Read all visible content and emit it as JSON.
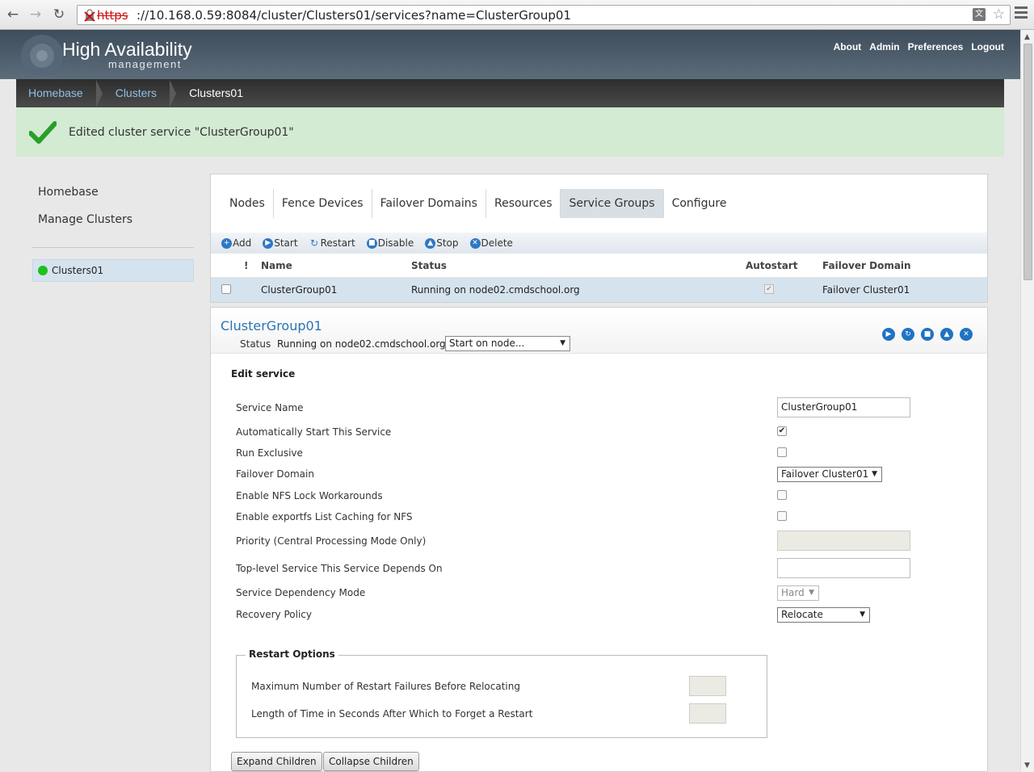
{
  "browser": {
    "url_protocol": "https",
    "url_rest": "://10.168.0.59:8084/cluster/Clusters01/services?name=ClusterGroup01"
  },
  "header": {
    "title": "High Availability",
    "subtitle": "management",
    "links": [
      "About",
      "Admin",
      "Preferences",
      "Logout"
    ]
  },
  "breadcrumb": [
    "Homebase",
    "Clusters",
    "Clusters01"
  ],
  "banner": {
    "message": "Edited cluster service \"ClusterGroup01\""
  },
  "sidebar": {
    "links": [
      "Homebase",
      "Manage Clusters"
    ],
    "cluster": {
      "name": "Clusters01",
      "status_color": "#1ec01e"
    }
  },
  "tabs": [
    "Nodes",
    "Fence Devices",
    "Failover Domains",
    "Resources",
    "Service Groups",
    "Configure"
  ],
  "active_tab": "Service Groups",
  "toolbar": [
    {
      "label": "Add",
      "icon": "plus-icon"
    },
    {
      "label": "Start",
      "icon": "play-icon"
    },
    {
      "label": "Restart",
      "icon": "restart-icon"
    },
    {
      "label": "Disable",
      "icon": "disable-icon"
    },
    {
      "label": "Stop",
      "icon": "stop-icon"
    },
    {
      "label": "Delete",
      "icon": "delete-icon"
    }
  ],
  "grid": {
    "headers": {
      "flag": "!",
      "name": "Name",
      "status": "Status",
      "autostart": "Autostart",
      "domain": "Failover Domain"
    },
    "rows": [
      {
        "name": "ClusterGroup01",
        "status": "Running on node02.cmdschool.org",
        "autostart": true,
        "domain": "Failover Cluster01"
      }
    ]
  },
  "service": {
    "title": "ClusterGroup01",
    "status_label": "Status",
    "status_value": "Running on node02.cmdschool.org",
    "node_select": "Start on node...",
    "edit_title": "Edit service",
    "fields": {
      "service_name": {
        "label": "Service Name",
        "value": "ClusterGroup01"
      },
      "autostart": {
        "label": "Automatically Start This Service",
        "checked": true
      },
      "run_exclusive": {
        "label": "Run Exclusive",
        "checked": false
      },
      "failover_domain": {
        "label": "Failover Domain",
        "value": "Failover Cluster01"
      },
      "nfs_lock": {
        "label": "Enable NFS Lock Workarounds",
        "checked": false
      },
      "exportfs_cache": {
        "label": "Enable exportfs List Caching for NFS",
        "checked": false
      },
      "priority": {
        "label": "Priority (Central Processing Mode Only)",
        "value": ""
      },
      "depends_on": {
        "label": "Top-level Service This Service Depends On",
        "value": ""
      },
      "dependency_mode": {
        "label": "Service Dependency Mode",
        "value": "Hard"
      },
      "recovery_policy": {
        "label": "Recovery Policy",
        "value": "Relocate"
      }
    },
    "restart_options": {
      "legend": "Restart Options",
      "max_failures_label": "Maximum Number of Restart Failures Before Relocating",
      "forget_label": "Length of Time in Seconds After Which to Forget a Restart"
    },
    "buttons": {
      "expand": "Expand Children",
      "collapse": "Collapse Children"
    }
  }
}
